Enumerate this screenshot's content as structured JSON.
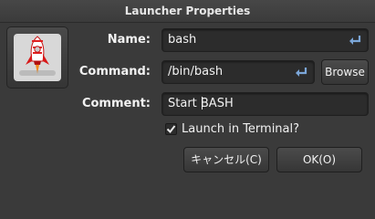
{
  "window": {
    "title": "Launcher Properties"
  },
  "icon": {
    "name": "rocket-icon"
  },
  "form": {
    "name_label": "Name:",
    "name_value": "bash",
    "command_label": "Command:",
    "command_value": "/bin/bash",
    "browse_label": "Browse",
    "comment_label": "Comment:",
    "comment_value": "Start BASH",
    "terminal_label": "Launch in Terminal?",
    "terminal_checked": true
  },
  "buttons": {
    "cancel_label": "キャンセル(C)",
    "ok_label": "OK(O)"
  }
}
